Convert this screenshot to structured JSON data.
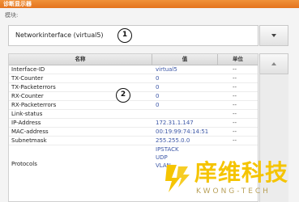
{
  "window": {
    "title": "诊断显示器"
  },
  "module": {
    "label": "模块:",
    "selected": "Networkinterface (virtual5)"
  },
  "callouts": {
    "one": "1",
    "two": "2"
  },
  "table": {
    "headers": {
      "name": "名称",
      "value": "值",
      "unit": "单位"
    },
    "rows": [
      {
        "name": "Interface-ID",
        "value": "virtual5",
        "unit": "--"
      },
      {
        "name": "TX-Counter",
        "value": "0",
        "unit": "--"
      },
      {
        "name": "TX-Packeterrors",
        "value": "0",
        "unit": "--"
      },
      {
        "name": "RX-Counter",
        "value": "0",
        "unit": "--"
      },
      {
        "name": "RX-Packeterrors",
        "value": "0",
        "unit": "--"
      },
      {
        "name": "Link-status",
        "value": "",
        "unit": "--"
      },
      {
        "name": "IP-Address",
        "value": "172.31.1.147",
        "unit": "--"
      },
      {
        "name": "MAC-address",
        "value": "00:19:99:74:14:51",
        "unit": "--"
      },
      {
        "name": "Subnetmask",
        "value": "255.255.0.0",
        "unit": "--"
      }
    ],
    "protocols": {
      "name": "Protocols",
      "values": [
        "IPSTACK",
        "UDP",
        "VLAN"
      ]
    }
  },
  "watermark": {
    "cn": "庠维科技",
    "en": "KWONG-TECH"
  }
}
